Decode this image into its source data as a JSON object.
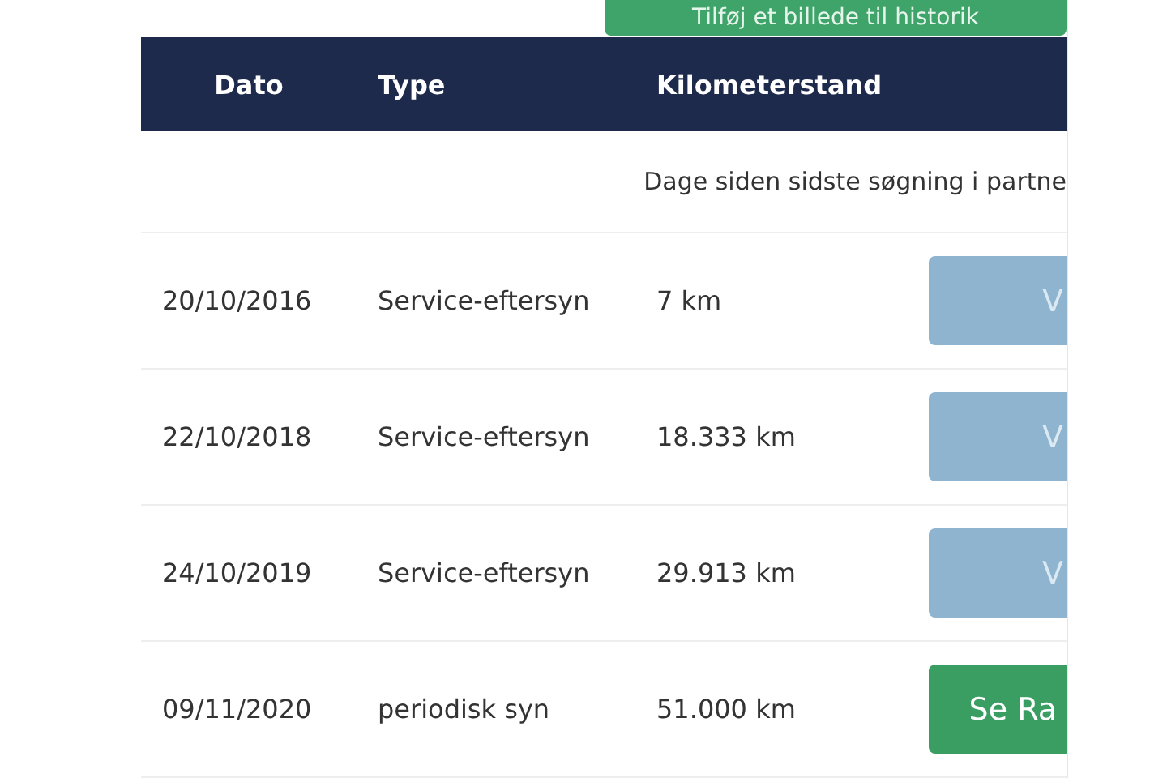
{
  "add_button": {
    "label": "Tilføj et billede til historik"
  },
  "table": {
    "columns": [
      "Dato",
      "Type",
      "Kilometerstand"
    ],
    "info_row": "Dage siden sidste søgning i partne",
    "rows": [
      {
        "date": "20/10/2016",
        "type": "Service-eftersyn",
        "mileage": "7 km",
        "action": {
          "label": "V",
          "disabled": true
        }
      },
      {
        "date": "22/10/2018",
        "type": "Service-eftersyn",
        "mileage": "18.333 km",
        "action": {
          "label": "V",
          "disabled": true
        }
      },
      {
        "date": "24/10/2019",
        "type": "Service-eftersyn",
        "mileage": "29.913 km",
        "action": {
          "label": "V",
          "disabled": true
        }
      },
      {
        "date": "09/11/2020",
        "type": "periodisk syn",
        "mileage": "51.000 km",
        "action": {
          "label": "Se Ra",
          "disabled": false
        }
      }
    ]
  }
}
